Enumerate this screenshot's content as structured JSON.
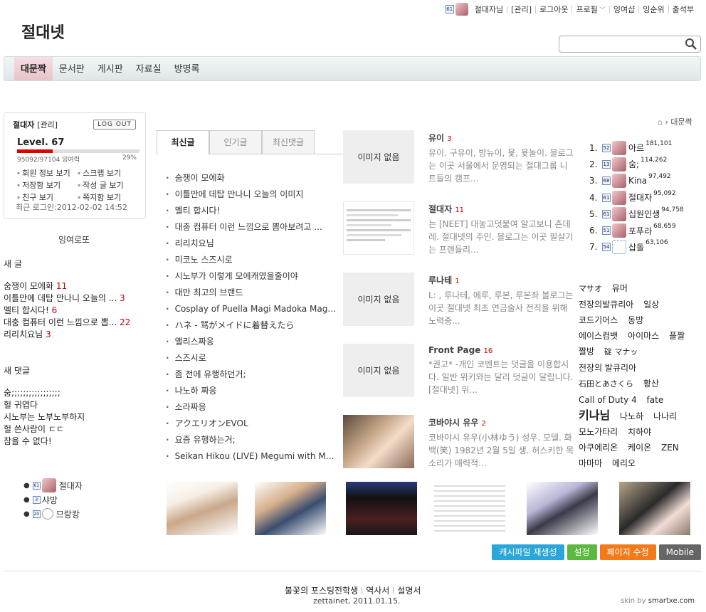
{
  "topbar": {
    "level": "61",
    "user": "절대자님",
    "items": [
      "[관리]",
      "로그아웃",
      "프로필",
      "잉여샵",
      "잉순위",
      "출석부"
    ]
  },
  "site_title": "절대넷",
  "search": {
    "placeholder": ""
  },
  "nav": [
    "대문짝",
    "문서판",
    "게시판",
    "자료실",
    "방명록"
  ],
  "login": {
    "name": "절대자",
    "role": "[관리]",
    "logout": "LOG OUT",
    "level": "Level. 67",
    "exp": "95092/97104 잉여력",
    "pct": "29%",
    "progress": 0.29,
    "links": [
      "회원 정보 보기",
      "스크랩 보기",
      "저장함 보기",
      "작성 글 보기",
      "친구 보기",
      "쪽지함 보기"
    ],
    "last_login": "최근 로그인:2012-02-02 14:52"
  },
  "left": {
    "title": "잉여로또",
    "new_posts_title": "새 글",
    "new_posts": [
      {
        "text": "숨쟁이 모에화",
        "count": "11"
      },
      {
        "text": "이틀만에 데탑 만나니 오늘의 ...",
        "count": "3"
      },
      {
        "text": "멜티 합시다!",
        "count": "6"
      },
      {
        "text": "대충 컴퓨터 이런 느낌으로 뽑...",
        "count": "22"
      },
      {
        "text": "리리치요님",
        "count": "3"
      }
    ],
    "new_comments_title": "새 댓글",
    "new_comments": [
      "숨;;;;;;;;;;;;;;;;;",
      "헐 귀엽다",
      "시노부는 노부노부하지",
      "헐 쓴사람이 ㄷㄷ",
      "참을 수 없다!"
    ],
    "users": [
      {
        "level": "61",
        "name": "절대자"
      },
      {
        "level": "3",
        "name": "샤방"
      },
      {
        "level": "20",
        "name": "므랑캉"
      }
    ]
  },
  "tabs": [
    "최신글",
    "인기글",
    "최신댓글"
  ],
  "recent": [
    "숨쟁이 모에화",
    "이틀만에 데탑 만나니 오늘의 이미지",
    "멜티 합시다!",
    "대충 컴퓨터 이런 느낌으로 뽑아보려고 ...",
    "리리치요님",
    "미코노 스즈시로",
    "시노부가 이렇게 모에캐였을줄이야",
    "대만 최고의 브랜드",
    "Cosplay of Puella Magi Madoka Magica ...",
    "ハネ - 骂がメイドに着替えたら",
    "앨리스짜응",
    "스즈시로",
    "좀 전에 유행하던거;",
    "나노하 짜응",
    "소라짜응",
    "アクエリオンEVOL",
    "요즘 유행하는거;",
    "Seikan Hikou (LIVE) Megumi with May..."
  ],
  "articles": [
    {
      "img": "이미지 없음",
      "title": "유이",
      "count": "3",
      "body": "유이. 구유이, 방뉴이, 윷, 윷놀이. 블로그는 이곳 서울에서 운영되는 절대그룹 니트들의 캠프..."
    },
    {
      "img": "",
      "title": "절대자",
      "count": "11",
      "body": "는 [NEET] 대놓고덧붙여 알고보니 츤데레. 절대넷의 주인. 블로그는 이곳 필살기는 프렌들리..."
    },
    {
      "img": "이미지 없음",
      "title": "루나테",
      "count": "1",
      "body": "L: , 루나테, 에루, 루본, 루본좌 블로그는 이곳 절대넷 최초 연금술사 전직을 위해 노력중..."
    },
    {
      "img": "이미지 없음",
      "title": "Front Page",
      "count": "16",
      "body": "*권고* -개인 코멘트는 덧글을 이용합시다. 일반 위키와는 달리 덧글이 달립니다. [절대넷] 위..."
    },
    {
      "img": "",
      "title": "코바야시 유우",
      "count": "2",
      "body": "코바야시 유우(小林ゆう) 성우. 모델. 화백(笑) 1982년 2월 5일 생. 허스키한 목소리가 매력적..."
    }
  ],
  "breadcrumb": "대문짝",
  "rank": [
    {
      "no": "1.",
      "level": "52",
      "name": "아르",
      "score": "181,101"
    },
    {
      "no": "2.",
      "level": "13",
      "name": "숨;",
      "score": "114,262"
    },
    {
      "no": "3.",
      "level": "68",
      "name": "Kina",
      "score": "97,492"
    },
    {
      "no": "4.",
      "level": "61",
      "name": "절대자",
      "score": "95,092"
    },
    {
      "no": "5.",
      "level": "61",
      "name": "십원인생",
      "score": "94,758"
    },
    {
      "no": "6.",
      "level": "51",
      "name": "포푸라",
      "score": "68,659"
    },
    {
      "no": "7.",
      "level": "54",
      "name": "삽돌",
      "score": "63,106"
    }
  ],
  "tags": [
    "マサオ",
    "유머",
    "전장의발큐리아",
    "일상",
    "코드기어스",
    "동방",
    "에이스컴뱃",
    "아이마스",
    "플짤",
    "짤방",
    "碇 マナッ",
    "전장의 발큐리아",
    "石田とあさくら",
    "황산",
    "Call of Duty 4",
    "fate",
    "키나님",
    "나노하",
    "나나리",
    "모노가타리",
    "치하야",
    "아쿠에리온",
    "케이온",
    "ZEN",
    "마마마",
    "에리오"
  ],
  "buttons": [
    {
      "label": "캐시파일 재생성",
      "color": "#2aa6d8"
    },
    {
      "label": "설정",
      "color": "#5cb83e"
    },
    {
      "label": "페이지 수정",
      "color": "#f27a1a"
    },
    {
      "label": "Mobile",
      "color": "#666666"
    }
  ],
  "footer": {
    "links": [
      "불꽃의 포스팅전학생",
      "역사서",
      "설명서"
    ],
    "copyright": "zettainet, 2011.01.15.",
    "skin_prefix": "skin by",
    "skin_name": "smartxe.com"
  }
}
